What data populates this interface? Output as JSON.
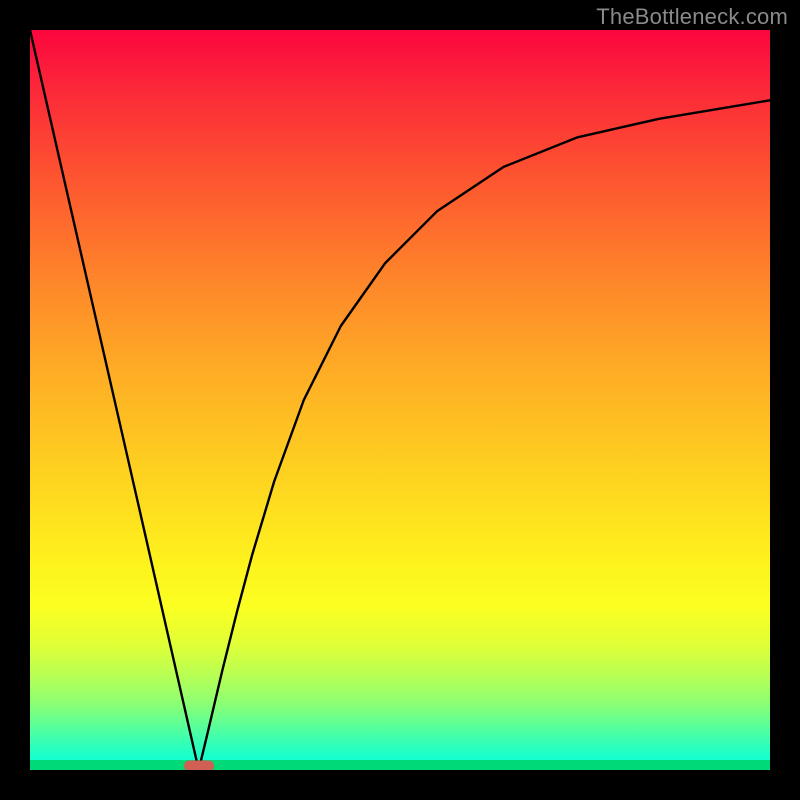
{
  "watermark": "TheBottleneck.com",
  "chart_data": {
    "type": "line",
    "title": "",
    "xlabel": "",
    "ylabel": "",
    "xlim": [
      0,
      1
    ],
    "ylim": [
      0,
      1
    ],
    "series": [
      {
        "name": "curve",
        "x": [
          0.0,
          0.05,
          0.1,
          0.15,
          0.2,
          0.228,
          0.24,
          0.26,
          0.28,
          0.3,
          0.33,
          0.37,
          0.42,
          0.48,
          0.55,
          0.64,
          0.74,
          0.85,
          0.94,
          1.0
        ],
        "y": [
          1.0,
          0.781,
          0.562,
          0.343,
          0.123,
          0.0,
          0.05,
          0.135,
          0.215,
          0.29,
          0.39,
          0.5,
          0.6,
          0.685,
          0.755,
          0.815,
          0.855,
          0.88,
          0.895,
          0.905
        ]
      }
    ],
    "marker": {
      "x": 0.228,
      "y": 0.005
    },
    "colors": {
      "curve": "#000000",
      "marker": "#d06054",
      "gradient_top": "#fb063e",
      "gradient_bottom": "#00ffe0",
      "frame": "#000000"
    }
  }
}
